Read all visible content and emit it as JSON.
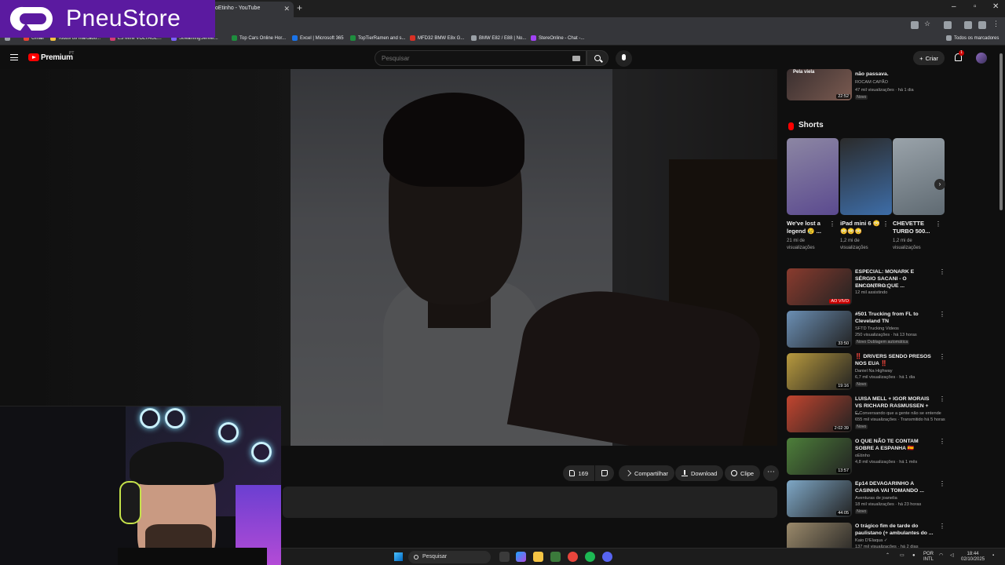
{
  "overlay_logo": {
    "text": "PneuStore"
  },
  "browser": {
    "tab": {
      "title": "oEtinho - YouTube"
    },
    "bookmarks": [
      {
        "label": "Gmail",
        "color": "#ea4335"
      },
      {
        "label": "Todos os marcado...",
        "color": "#f5c242"
      },
      {
        "label": "E3 MINI VOLTAGE...",
        "color": "#d63b74"
      },
      {
        "label": "StreamingServer...",
        "color": "#7b61ff"
      },
      {
        "label": "Top Cars Online Hor...",
        "color": "#1e8e3e"
      },
      {
        "label": "Excel | Microsoft 365",
        "color": "#1a73e8"
      },
      {
        "label": "TopTierRamen and s...",
        "color": "#1e8e3e"
      },
      {
        "label": "MFD32 BMW E8x G...",
        "color": "#d93025"
      },
      {
        "label": "BMW E82 / E88 | No...",
        "color": "#9aa0a6"
      },
      {
        "label": "StereOnline - Chat -...",
        "color": "#a142f4"
      }
    ],
    "all_bookmarks": "Todos os marcadores"
  },
  "youtube_header": {
    "brand": "Premium",
    "region": "PT",
    "search_placeholder": "Pesquisar",
    "create_label": "Criar",
    "notification_count": "1"
  },
  "actions": {
    "like_count": "169",
    "share_label": "Compartilhar",
    "download_label": "Download",
    "clip_label": "Clipe"
  },
  "sidebar": {
    "top_video": {
      "title": "não passava.",
      "channel": "ROCAM CAPÃO",
      "meta": "47 mil visualizações · há 1 dia",
      "badge": "Novo",
      "duration": "22:52",
      "thumb_text": "Pela viela"
    },
    "shorts_heading": "Shorts",
    "shorts": [
      {
        "title": "We've lost a legend 😢 ...",
        "views": "21 mi de visualizações",
        "color": "#5b4a8f"
      },
      {
        "title": "iPad mini 6 😳😳😳😳",
        "views": "1,2 mi de visualizações",
        "color": "#3d6da8"
      },
      {
        "title": "CHEVETTE TURBO 500...",
        "views": "1,2 mi de visualizações",
        "color": "#7c8a96"
      }
    ],
    "videos": [
      {
        "title": "ESPECIAL: MONARK E SÉRGIO SACANI - O ENCONTRO QUE ...",
        "channel": "RedCast [Oficial]",
        "meta": "12 mil assistindo",
        "badge": "",
        "duration": "AO VIVO",
        "color": "#8a3b2e"
      },
      {
        "title": "#501 Trucking from FL to Cleveland TN",
        "channel": "SFTD Trucking Videos",
        "meta": "250 visualizações · há 13 horas",
        "badge": "Novo   Dublagem automática",
        "duration": "33:50",
        "color": "#6b8fb4"
      },
      {
        "title": "‼️ DRIVERS SENDO PRESOS NOS EUA ‼️",
        "channel": "Daniel Na Highway",
        "meta": "6,7 mil visualizações · há 1 dia",
        "badge": "Novo",
        "duration": "19:16",
        "color": "#b89a3e"
      },
      {
        "title": "LUISA MELL + IGOR MORAIS VS RICHARD RASMUSSEN + ...",
        "channel": "É Conversando que a gente não se entende",
        "meta": "655 mil visualizações · Transmitido há 5 horas",
        "badge": "Novo",
        "duration": "2:02:39",
        "color": "#c2452f"
      },
      {
        "title": "O QUE NÃO TE CONTAM SOBRE A ESPANHA 🇪🇸",
        "channel": "oEtinho",
        "meta": "4,8 mil visualizações · há 1 mês",
        "badge": "",
        "duration": "13:57",
        "color": "#4d7f3a"
      },
      {
        "title": "Ep14 DEVAGARINHO A CASINHA VAI TOMANDO ...",
        "channel": "Aventuras de joanelia",
        "meta": "18 mil visualizações · há 23 horas",
        "badge": "Novo",
        "duration": "44:05",
        "color": "#7fa8c7"
      },
      {
        "title": "O trágico fim de tarde do paulistano (+ ambulantes do ...",
        "channel": "Kaio D'Elaqua ✓",
        "meta": "137 mil visualizações · há 2 dias",
        "badge": "",
        "duration": "",
        "color": "#9b8a6b"
      }
    ]
  },
  "taskbar": {
    "search_label": "Pesquisar",
    "lang": "POR",
    "lang2": "INTL",
    "time": "18:44",
    "date": "02/10/2025"
  }
}
